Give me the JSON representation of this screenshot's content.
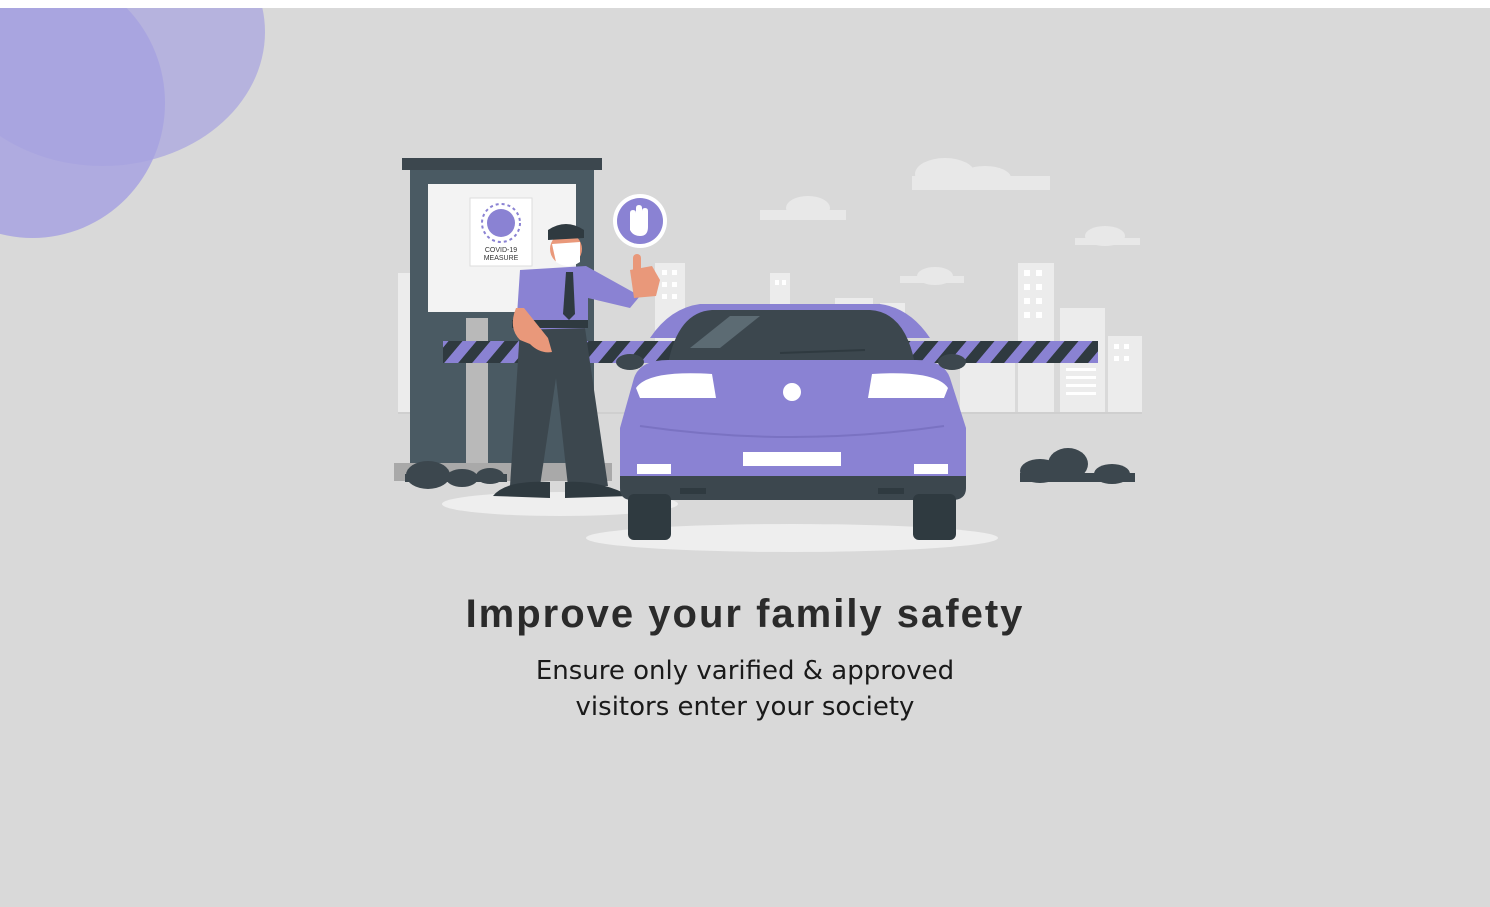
{
  "onboarding": {
    "illustration": {
      "sign_line1": "COVID-19",
      "sign_line2": "MEASURE",
      "hand_icon": "stop-hand-icon"
    },
    "title": "Improve your family safety",
    "subtitle_line1": "Ensure  only varified & approved",
    "subtitle_line2": "visitors enter your society"
  },
  "colors": {
    "background": "#d9d9d9",
    "accent": "#8a82d3",
    "dark": "#3c474e"
  }
}
